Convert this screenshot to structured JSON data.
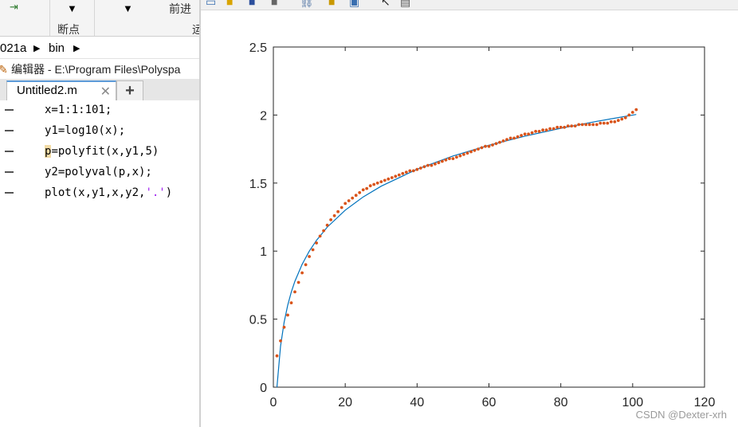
{
  "ribbon": {
    "breakpoints_label": "断点",
    "forward_label": "前进",
    "run_label_partial": "运"
  },
  "address": {
    "path_start": "021a",
    "folder": "bin"
  },
  "editor": {
    "title": "编辑器 - E:\\Program Files\\Polyspa",
    "tabs": [
      {
        "label": "Untitled2.m",
        "active": true
      }
    ],
    "close_glyph": "✕",
    "add_glyph": "+"
  },
  "code_lines": [
    {
      "text": "x=1:1:101;"
    },
    {
      "text": "y1=log10(x);"
    },
    {
      "text": "=polyfit(x,y1,5)",
      "hl": "p"
    },
    {
      "text": "y2=polyval(p,x);"
    },
    {
      "pre": "plot(x,y1,x,y2,",
      "str": "'.'",
      "post": ")"
    }
  ],
  "chart_data": {
    "type": "line",
    "title": "",
    "xlabel": "",
    "ylabel": "",
    "xlim": [
      0,
      120
    ],
    "ylim": [
      0,
      2.5
    ],
    "xticks": [
      0,
      20,
      40,
      60,
      80,
      100,
      120
    ],
    "yticks": [
      0,
      0.5,
      1,
      1.5,
      2,
      2.5
    ],
    "ytick_labels": [
      "0",
      "0.5",
      "1",
      "1.5",
      "2",
      "2.5"
    ],
    "grid": false,
    "series": [
      {
        "style": "line",
        "color": "#0072bd",
        "x": [
          1,
          2,
          3,
          4,
          5,
          6,
          8,
          10,
          12,
          15,
          20,
          25,
          30,
          40,
          50,
          60,
          70,
          80,
          90,
          101
        ],
        "values": [
          0,
          0.301,
          0.477,
          0.602,
          0.699,
          0.778,
          0.903,
          1.0,
          1.079,
          1.176,
          1.301,
          1.398,
          1.477,
          1.602,
          1.699,
          1.778,
          1.845,
          1.903,
          1.954,
          2.004
        ]
      },
      {
        "style": "dots",
        "color": "#d95319",
        "x": [
          1,
          2,
          3,
          4,
          5,
          6,
          7,
          8,
          9,
          10,
          11,
          12,
          13,
          14,
          15,
          16,
          17,
          18,
          19,
          20,
          21,
          22,
          23,
          24,
          25,
          26,
          27,
          28,
          29,
          30,
          31,
          32,
          33,
          34,
          35,
          36,
          37,
          38,
          39,
          40,
          41,
          42,
          43,
          44,
          45,
          46,
          47,
          48,
          49,
          50,
          51,
          52,
          53,
          54,
          55,
          56,
          57,
          58,
          59,
          60,
          61,
          62,
          63,
          64,
          65,
          66,
          67,
          68,
          69,
          70,
          71,
          72,
          73,
          74,
          75,
          76,
          77,
          78,
          79,
          80,
          81,
          82,
          83,
          84,
          85,
          86,
          87,
          88,
          89,
          90,
          91,
          92,
          93,
          94,
          95,
          96,
          97,
          98,
          99,
          100,
          101
        ],
        "values": [
          0.23,
          0.34,
          0.44,
          0.53,
          0.62,
          0.7,
          0.77,
          0.84,
          0.9,
          0.96,
          1.01,
          1.06,
          1.11,
          1.15,
          1.19,
          1.23,
          1.26,
          1.29,
          1.32,
          1.35,
          1.37,
          1.39,
          1.41,
          1.43,
          1.45,
          1.46,
          1.48,
          1.49,
          1.5,
          1.51,
          1.52,
          1.53,
          1.54,
          1.55,
          1.56,
          1.57,
          1.58,
          1.59,
          1.59,
          1.6,
          1.61,
          1.62,
          1.63,
          1.63,
          1.64,
          1.65,
          1.66,
          1.67,
          1.68,
          1.68,
          1.69,
          1.7,
          1.71,
          1.72,
          1.73,
          1.74,
          1.75,
          1.76,
          1.77,
          1.77,
          1.78,
          1.79,
          1.8,
          1.81,
          1.82,
          1.83,
          1.83,
          1.84,
          1.85,
          1.86,
          1.86,
          1.87,
          1.88,
          1.88,
          1.89,
          1.89,
          1.9,
          1.9,
          1.91,
          1.91,
          1.91,
          1.92,
          1.92,
          1.92,
          1.93,
          1.93,
          1.93,
          1.93,
          1.93,
          1.93,
          1.94,
          1.94,
          1.94,
          1.95,
          1.95,
          1.96,
          1.97,
          1.98,
          2.0,
          2.02,
          2.04
        ]
      }
    ]
  },
  "watermark": "CSDN @Dexter-xrh"
}
